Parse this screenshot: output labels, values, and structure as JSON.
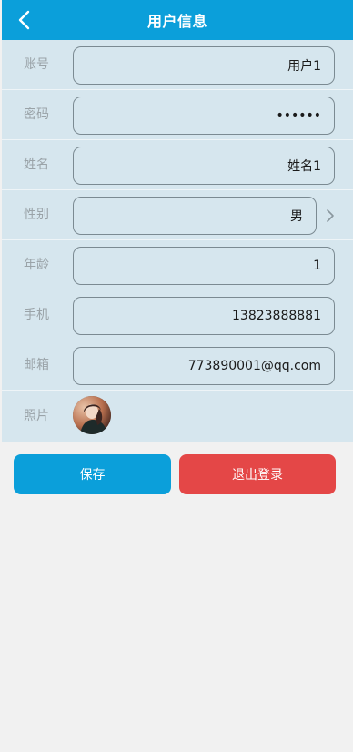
{
  "header": {
    "title": "用户信息",
    "back_icon": "chevron-left-icon"
  },
  "form": {
    "account": {
      "label": "账号",
      "value": "用户1"
    },
    "password": {
      "label": "密码",
      "value": "••••••"
    },
    "name": {
      "label": "姓名",
      "value": "姓名1"
    },
    "gender": {
      "label": "性别",
      "value": "男",
      "icon": "chevron-right-icon"
    },
    "age": {
      "label": "年龄",
      "value": "1"
    },
    "phone": {
      "label": "手机",
      "value": "13823888881"
    },
    "email": {
      "label": "邮箱",
      "value": "773890001@qq.com"
    },
    "photo": {
      "label": "照片"
    }
  },
  "actions": {
    "save_label": "保存",
    "logout_label": "退出登录"
  },
  "colors": {
    "header": "#0b9fda",
    "row_bg": "#d6e6ee",
    "save": "#0b9fda",
    "logout": "#e44747",
    "page_bg": "#f1f1f1"
  }
}
